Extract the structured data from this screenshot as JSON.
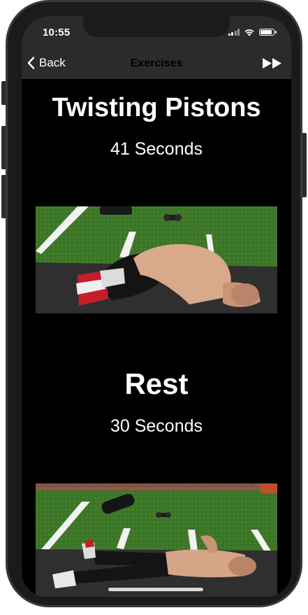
{
  "status_bar": {
    "time": "10:55"
  },
  "nav": {
    "back_label": "Back",
    "title": "Exercises",
    "back_icon": "chevron-left-icon",
    "forward_icon": "fast-forward-icon"
  },
  "exercises": [
    {
      "name": "Twisting Pistons",
      "duration": "41 Seconds"
    },
    {
      "name": "Rest",
      "duration": "30 Seconds"
    }
  ],
  "colors": {
    "bar_background": "#2b2b2b",
    "content_background": "#000000",
    "text": "#ffffff",
    "turf_green": "#3f7a2a"
  }
}
